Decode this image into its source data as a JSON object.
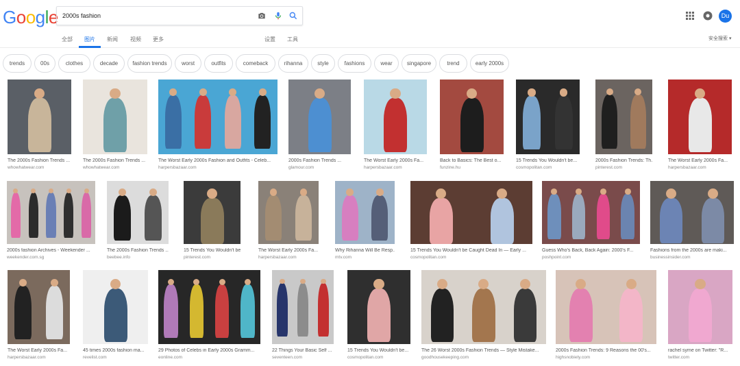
{
  "search": {
    "query": "2000s fashion"
  },
  "logo": {
    "letters": [
      "G",
      "o",
      "o",
      "g",
      "l",
      "e"
    ],
    "colors": [
      "#4285f4",
      "#ea4335",
      "#fbbc05",
      "#4285f4",
      "#34a853",
      "#ea4335"
    ]
  },
  "user": {
    "initials": "Du"
  },
  "tabs": [
    {
      "label": "全部",
      "active": false
    },
    {
      "label": "图片",
      "active": true
    },
    {
      "label": "新闻",
      "active": false
    },
    {
      "label": "视频",
      "active": false
    },
    {
      "label": "更多",
      "active": false
    },
    {
      "label": "设置",
      "active": false
    },
    {
      "label": "工具",
      "active": false
    }
  ],
  "safesearch_label": "安全搜索 ▾",
  "chips": [
    "trends",
    "00s",
    "clothes",
    "decade",
    "fashion trends",
    "worst",
    "outfits",
    "comeback",
    "rihanna",
    "style",
    "fashions",
    "wear",
    "singapore",
    "trend",
    "early 2000s"
  ],
  "rows": [
    [
      {
        "title": "The 2000s Fashion Trends ...",
        "source": "whowhatwear.com",
        "bg": "#5a5f66",
        "figs": [
          "#c8b59a"
        ]
      },
      {
        "title": "The 2000s Fashion Trends ...",
        "source": "whowhatwear.com",
        "bg": "#e9e4dd",
        "figs": [
          "#6fa0a8"
        ]
      },
      {
        "title": "The Worst Early 2000s Fashion and Outfits - Celeb...",
        "source": "harpersbazaar.com",
        "bg": "#4aa6d4",
        "figs": [
          "#3a6fa5",
          "#c93b3b",
          "#d8a7a0",
          "#222222"
        ]
      },
      {
        "title": "2000s Fashion Trends ...",
        "source": "glamour.com",
        "bg": "#7c7f86",
        "figs": [
          "#4d8fd1"
        ]
      },
      {
        "title": "The Worst Early 2000s Fa...",
        "source": "harpersbazaar.com",
        "bg": "#b9d9e6",
        "figs": [
          "#c23030"
        ]
      },
      {
        "title": "Back to Basics: The Best o...",
        "source": "funzine.hu",
        "bg": "#a34a40",
        "figs": [
          "#1d1d1d"
        ]
      },
      {
        "title": "15 Trends You Wouldn't be...",
        "source": "cosmopolitan.com",
        "bg": "#2a2a2a",
        "figs": [
          "#7aa3c9",
          "#333333"
        ]
      },
      {
        "title": "2000s Fashion Trends: Th...",
        "source": "pinterest.com",
        "bg": "#6b6460",
        "figs": [
          "#1f1f1f",
          "#a07a5d"
        ]
      },
      {
        "title": "The Worst Early 2000s Fa...",
        "source": "harpersbazaar.com",
        "bg": "#b52a2a",
        "figs": [
          "#e8e8e8"
        ]
      }
    ],
    [
      {
        "title": "2000s fashion Archives - Weekender ...",
        "source": "weekender.com.sg",
        "bg": "#c7c2bd",
        "figs": [
          "#e36aa8",
          "#2c2c2c",
          "#6a7fb5",
          "#2f2f2f",
          "#d96aa8"
        ]
      },
      {
        "title": "The 2000s Fashion Trends ...",
        "source": "beebee.info",
        "bg": "#dcdcdc",
        "figs": [
          "#1b1b1b",
          "#555555"
        ]
      },
      {
        "title": "15 Trends You Wouldn't be...",
        "source": "pinterest.com",
        "bg": "#3b3b3b",
        "figs": [
          "#8a7a5a"
        ]
      },
      {
        "title": "The Worst Early 2000s Fa...",
        "source": "harpersbazaar.com",
        "bg": "#8a8178",
        "figs": [
          "#a38c72",
          "#c7b29a"
        ]
      },
      {
        "title": "Why Rihanna Will Be Resp...",
        "source": "mtv.com",
        "bg": "#9eb3c8",
        "figs": [
          "#d77fc0",
          "#555f78"
        ]
      },
      {
        "title": "15 Trends You Wouldn't be Caught Dead In — Early ...",
        "source": "cosmopolitan.com",
        "bg": "#5c3d33",
        "figs": [
          "#e8a4a4",
          "#b0c4de"
        ]
      },
      {
        "title": "Guess Who's Back, Back Again: 2000's F...",
        "source": "poshpoint.com",
        "bg": "#7a4b4b",
        "figs": [
          "#6e8fbb",
          "#9aa9bd",
          "#e04b8a",
          "#6b84b0"
        ]
      },
      {
        "title": "Fashions from the 2000s are maki...",
        "source": "businessinsider.com",
        "bg": "#5f5a57",
        "figs": [
          "#6c84b4",
          "#7c8aa6"
        ]
      }
    ],
    [
      {
        "title": "The Worst Early 2000s Fa...",
        "source": "harpersbazaar.com",
        "bg": "#7b6a5d",
        "figs": [
          "#222222",
          "#dcdcdc"
        ]
      },
      {
        "title": "45 times 2000s fashion ma...",
        "source": "revelist.com",
        "bg": "#efefef",
        "figs": [
          "#3c5a78"
        ]
      },
      {
        "title": "29 Photos of Celebs in Early 2000s Gramm...",
        "source": "eonline.com",
        "bg": "#272727",
        "figs": [
          "#b07ab8",
          "#d4b830",
          "#c94040",
          "#4fb6c8"
        ]
      },
      {
        "title": "22 Things Your Basic Self ...",
        "source": "seventeen.com",
        "bg": "#c9c9c9",
        "figs": [
          "#27356b",
          "#8c8c8c",
          "#c33030"
        ]
      },
      {
        "title": "15 Trends You Wouldn't be...",
        "source": "cosmopolitan.com",
        "bg": "#2f2f2f",
        "figs": [
          "#e0a6a6"
        ]
      },
      {
        "title": "The 26 Worst 2000s Fashion Trends — Style Mistake...",
        "source": "goodhousekeeping.com",
        "bg": "#d8d2cb",
        "figs": [
          "#222222",
          "#a3764e",
          "#3a3a3a"
        ]
      },
      {
        "title": "2000s Fashion Trends: 9 Reasons the 00's...",
        "source": "highsnobiety.com",
        "bg": "#d7c3b8",
        "figs": [
          "#e381b0",
          "#f3b6c8"
        ]
      },
      {
        "title": "rachel syme on Twitter: \"R...",
        "source": "twitter.com",
        "bg": "#d9a6c4",
        "figs": [
          "#f0a8d0"
        ]
      }
    ]
  ]
}
